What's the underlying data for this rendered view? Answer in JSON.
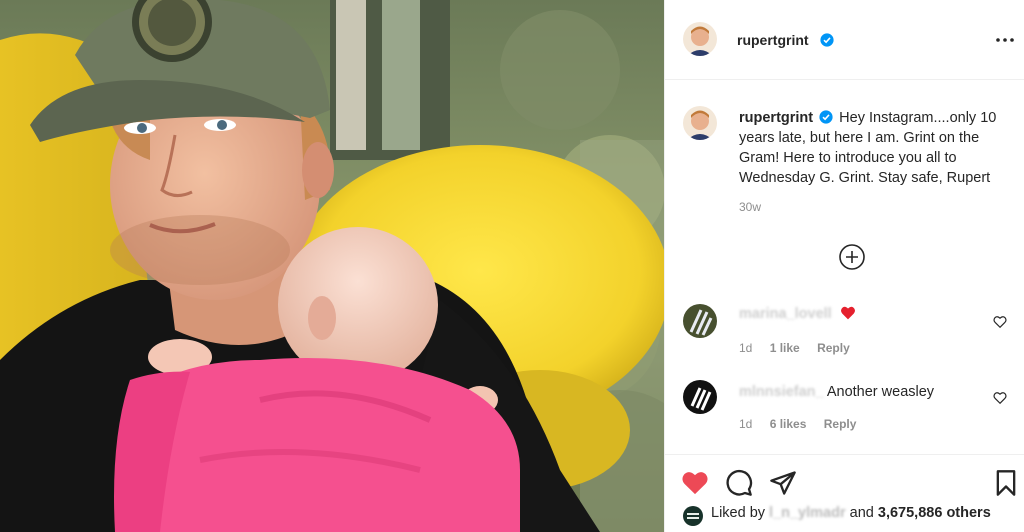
{
  "post": {
    "author": "rupertgrint",
    "caption": "Hey Instagram....only 10 years late, but here I am. Grint on the Gram! Here to introduce you all to Wednesday G. Grint. Stay safe, Rupert",
    "time_ago": "30w"
  },
  "comments": [
    {
      "user": "marina_lovell",
      "text": "",
      "emoji": "red-heart",
      "age": "1d",
      "likes": "1 like",
      "reply": "Reply"
    },
    {
      "user": "mlnnsiefan_",
      "text": "Another weasley",
      "age": "1d",
      "likes": "6 likes",
      "reply": "Reply"
    }
  ],
  "likes": {
    "prefix": "Liked by",
    "user": "l_n_ylmadr",
    "middle": "and",
    "count": "3,675,886",
    "suffix": "others"
  },
  "icons": {
    "header_more": "more-horizontal-icon",
    "verified": "verified-badge-icon",
    "load_more": "plus-circle-icon",
    "like": "heart-filled-icon",
    "comment": "comment-icon",
    "share": "paper-plane-icon",
    "save": "bookmark-icon"
  },
  "colors": {
    "verified": "#0095f6",
    "like_red": "#ed4956",
    "text": "#262626",
    "muted": "#8e8e8e",
    "divider": "#efefef"
  }
}
